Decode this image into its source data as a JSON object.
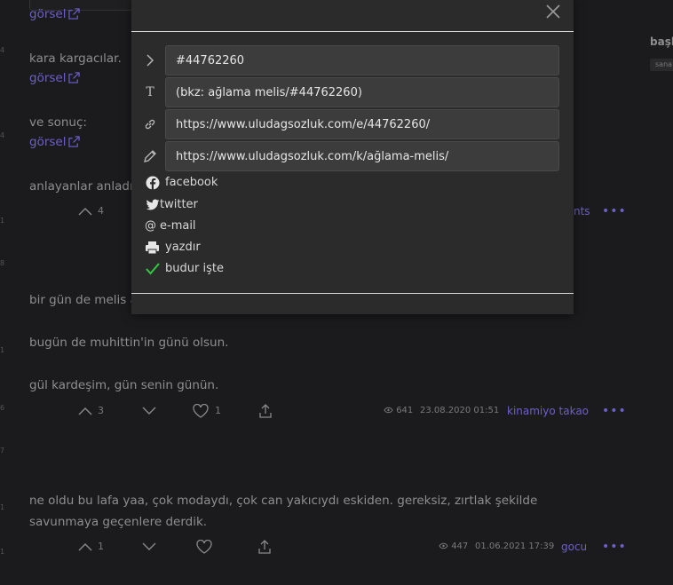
{
  "entries": {
    "top_link": "görsel",
    "e1_text": "kara kargacılar.",
    "e1_link": "görsel",
    "e2_text": "ve sonuç:",
    "e2_link": "görsel",
    "e3_text": "anlayanlar anladı",
    "e3_up": "4",
    "e3_author_partial": "nts",
    "e4_line1": "bir gün de melis a",
    "e4_line2": "bugün de muhittin'in günü olsun.",
    "e4_line3": "gül kardeşim, gün senin günün.",
    "e4_up": "3",
    "e4_fav": "1",
    "e4_views": "641",
    "e4_date": "23.08.2020 01:51",
    "e4_author": "kinamiyo takao",
    "e5_text": "ne oldu bu lafa yaa, çok modaydı, çok can yakıcıydı eskiden. gereksiz, zırtlak şekilde savunmaya geçenlere derdik.",
    "e5_up": "1",
    "e5_views": "447",
    "e5_date": "01.06.2021 17:39",
    "e5_author": "gocu"
  },
  "gutter": [
    "4",
    "4",
    "1",
    "8",
    "1",
    "6",
    "7",
    "1",
    "1"
  ],
  "right_sidebar": {
    "title": "başl",
    "tag": "sana"
  },
  "share_modal": {
    "fields": {
      "entry_id": "#44762260",
      "bkz": "(bkz: ağlama melis/#44762260)",
      "entry_url": "https://www.uludagsozluk.com/e/44762260/",
      "topic_url": "https://www.uludagsozluk.com/k/ağlama-melis/"
    },
    "options": {
      "facebook": "facebook",
      "twitter": "twitter",
      "email": "e-mail",
      "print": "yazdır",
      "done": "budur işte"
    }
  },
  "colors": {
    "accent": "#6c5fc7",
    "modal_bg": "#2b2b2b",
    "page_bg": "#1b1b1d",
    "check": "#2ecc40"
  }
}
